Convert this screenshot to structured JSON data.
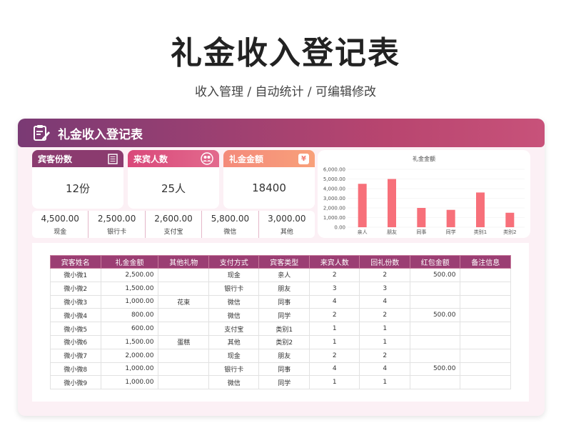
{
  "title": "礼金收入登记表",
  "subtitle": "收入管理 / 自动统计 /  可编辑修改",
  "banner": {
    "title": "礼金收入登记表",
    "icon": "clipboard-edit-icon"
  },
  "kpis": [
    {
      "label": "宾客份数",
      "value": "12份",
      "icon": "list-icon",
      "color": "#8b3b6f"
    },
    {
      "label": "来宾人数",
      "value": "25人",
      "icon": "users-icon",
      "color": "#d9487a"
    },
    {
      "label": "礼金金额",
      "value": "18400",
      "icon": "money-icon",
      "color": "#f27d72"
    }
  ],
  "payments": [
    {
      "value": "4,500.00",
      "label": "现金"
    },
    {
      "value": "2,500.00",
      "label": "银行卡"
    },
    {
      "value": "2,600.00",
      "label": "支付宝"
    },
    {
      "value": "5,800.00",
      "label": "微信"
    },
    {
      "value": "3,000.00",
      "label": "其他"
    }
  ],
  "chart_data": {
    "type": "bar",
    "title": "礼金金额",
    "categories": [
      "亲人",
      "朋友",
      "同事",
      "同学",
      "类别1",
      "类别2"
    ],
    "values": [
      4500,
      5000,
      2000,
      1800,
      3600,
      1500
    ],
    "ylim": [
      0,
      6000
    ],
    "yticks": [
      "0.00",
      "1,000.00",
      "2,000.00",
      "3,000.00",
      "4,000.00",
      "5,000.00",
      "6,000.00"
    ],
    "bar_color": "#f7707a"
  },
  "table": {
    "headers": [
      "宾客姓名",
      "礼金金额",
      "其他礼物",
      "支付方式",
      "宾客类型",
      "来宾人数",
      "回礼份数",
      "红包金额",
      "备注信息"
    ],
    "rows": [
      [
        "微小微1",
        "2,500.00",
        "",
        "现金",
        "亲人",
        "2",
        "2",
        "500.00",
        ""
      ],
      [
        "微小微2",
        "1,500.00",
        "",
        "银行卡",
        "朋友",
        "3",
        "3",
        "",
        ""
      ],
      [
        "微小微3",
        "1,000.00",
        "花束",
        "微信",
        "同事",
        "4",
        "4",
        "",
        ""
      ],
      [
        "微小微4",
        "800.00",
        "",
        "微信",
        "同学",
        "2",
        "2",
        "500.00",
        ""
      ],
      [
        "微小微5",
        "600.00",
        "",
        "支付宝",
        "类别1",
        "1",
        "1",
        "",
        ""
      ],
      [
        "微小微6",
        "1,500.00",
        "蛋糕",
        "其他",
        "类别2",
        "1",
        "1",
        "",
        ""
      ],
      [
        "微小微7",
        "2,000.00",
        "",
        "现金",
        "朋友",
        "2",
        "2",
        "",
        ""
      ],
      [
        "微小微8",
        "1,000.00",
        "",
        "银行卡",
        "同事",
        "4",
        "4",
        "500.00",
        ""
      ],
      [
        "微小微9",
        "1,000.00",
        "",
        "微信",
        "同学",
        "1",
        "1",
        "",
        ""
      ]
    ]
  }
}
